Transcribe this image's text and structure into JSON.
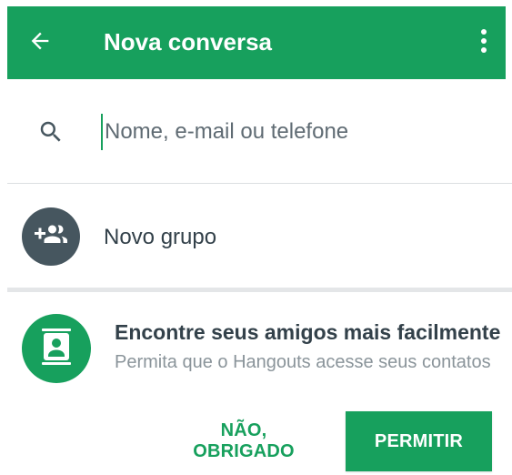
{
  "toolbar": {
    "title": "Nova conversa",
    "back_icon": "arrow-back-icon",
    "menu_icon": "more-vert-icon",
    "background_color": "#17a05d"
  },
  "search": {
    "placeholder": "Nome, e-mail ou telefone",
    "value": "",
    "icon": "search-icon"
  },
  "new_group": {
    "label": "Novo grupo",
    "icon": "group-add-icon"
  },
  "contacts_prompt": {
    "icon": "contacts-icon",
    "heading": "Encontre seus amigos mais facilmente",
    "body": "Permita que o Hangouts acesse seus contatos",
    "decline_label": "NÃO, OBRIGADO",
    "allow_label": "PERMITIR"
  },
  "colors": {
    "accent": "#17a05d",
    "avatar_dark": "#46565f",
    "text_primary": "#33414a",
    "text_secondary": "#8a949a"
  }
}
